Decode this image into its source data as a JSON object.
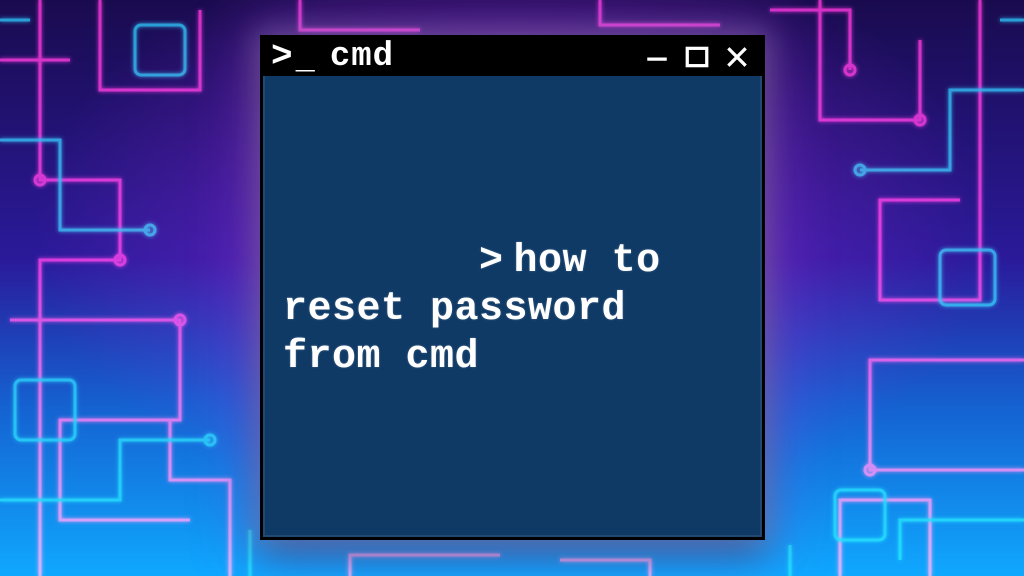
{
  "window": {
    "title": "cmd",
    "prompt_icon": {
      "gt": ">",
      "underscore": "_"
    },
    "controls": {
      "minimize_label": "Minimize",
      "maximize_label": "Maximize",
      "close_label": "Close"
    }
  },
  "terminal": {
    "prompt": ">",
    "command_text": "how to reset password from cmd"
  },
  "colors": {
    "terminal_bg": "#0f3a66",
    "titlebar_bg": "#000000",
    "text": "#ffffff",
    "neon_pink": "#ff2fd0",
    "neon_blue": "#18c8ff"
  }
}
